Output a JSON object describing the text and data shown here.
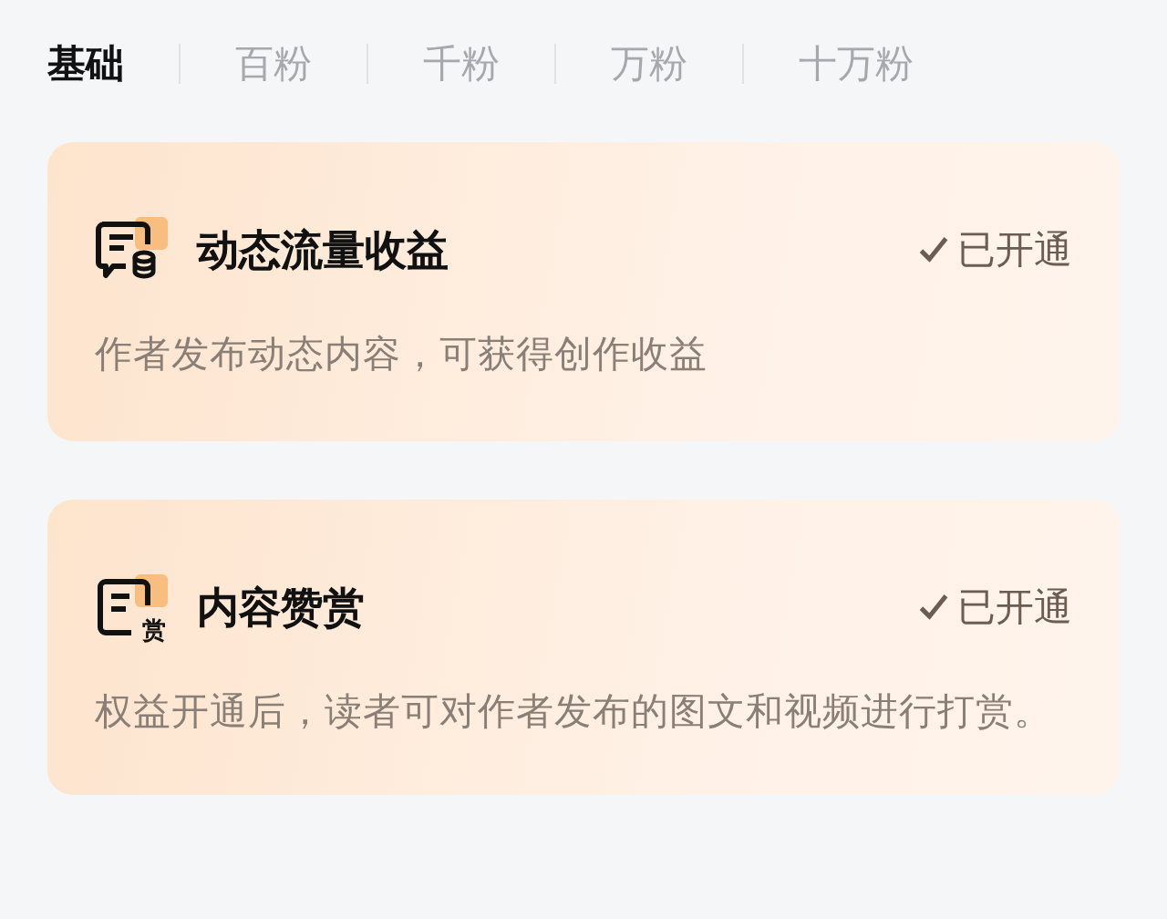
{
  "tabs": [
    {
      "label": "基础",
      "selected": true
    },
    {
      "label": "百粉",
      "selected": false
    },
    {
      "label": "千粉",
      "selected": false
    },
    {
      "label": "万粉",
      "selected": false
    },
    {
      "label": "十万粉",
      "selected": false
    }
  ],
  "cards": [
    {
      "kind": "traffic",
      "title": "动态流量收益",
      "status": "已开通",
      "enabled": true,
      "description": "作者发布动态内容，可获得创作收益"
    },
    {
      "kind": "reward",
      "icon_text": "赏",
      "title": "内容赞赏",
      "status": "已开通",
      "enabled": true,
      "description": "权益开通后，读者可对作者发布的图文和视频进行打赏。"
    }
  ]
}
